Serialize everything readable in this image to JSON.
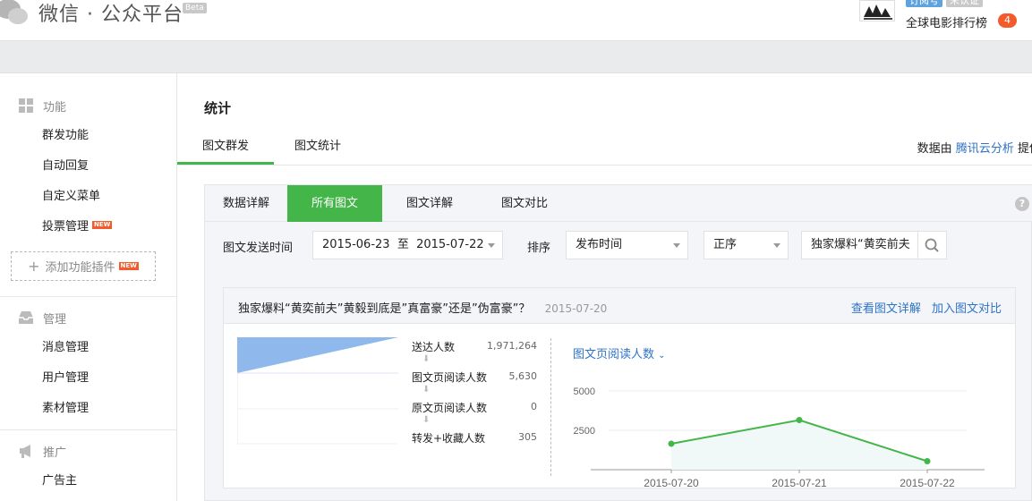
{
  "header": {
    "logo_text": "微信 · 公众平台",
    "beta": "Beta",
    "account_badge_sub": "订阅号",
    "account_badge_verify": "未认证",
    "account_name": "全球电影排行榜",
    "notification_count": "4"
  },
  "sidebar": {
    "groups": [
      {
        "title": "功能",
        "icon": "grid-icon"
      },
      {
        "title": "管理",
        "icon": "inbox-icon"
      },
      {
        "title": "推广",
        "icon": "megaphone-icon"
      }
    ],
    "function_items": [
      "群发功能",
      "自动回复",
      "自定义菜单",
      "投票管理"
    ],
    "new_tag": "NEW",
    "add_plugin": "添加功能插件",
    "manage_items": [
      "消息管理",
      "用户管理",
      "素材管理"
    ],
    "promo_items": [
      "广告主"
    ]
  },
  "main": {
    "title": "统计",
    "tabs": [
      "图文群发",
      "图文统计"
    ],
    "data_source_prefix": "数据由",
    "data_source_link": "腾讯云分析",
    "data_source_suffix": "提供",
    "subtabs": [
      "数据详解",
      "所有图文",
      "图文详解",
      "图文对比"
    ],
    "help": "?",
    "filters": {
      "time_label": "图文发送时间",
      "date_range": "2015-06-23  至  2015-07-22",
      "sort_label": "排序",
      "sort_field": "发布时间",
      "sort_order": "正序",
      "search_value": "独家爆料“黄奕前夫"
    },
    "card": {
      "title": "独家爆料“黄奕前夫”黄毅到底是”真富豪”还是”伪富豪”？",
      "date": "2015-07-20",
      "link_detail": "查看图文详解",
      "link_compare": "加入图文对比",
      "funnel": [
        {
          "label": "送达人数",
          "value": "1,971,264"
        },
        {
          "label": "图文页阅读人数",
          "value": "5,630"
        },
        {
          "label": "原文页阅读人数",
          "value": "0"
        },
        {
          "label": "转发+收藏人数",
          "value": "305"
        }
      ],
      "chart_title": "图文页阅读人数"
    }
  },
  "chart_data": {
    "type": "line",
    "x": [
      "2015-07-20",
      "2015-07-21",
      "2015-07-22"
    ],
    "series": [
      {
        "values": [
          1650,
          3150,
          540
        ]
      }
    ],
    "ylim": [
      0,
      5000
    ],
    "yticks": [
      "5000",
      "2500"
    ],
    "color": "#44b549",
    "fill": "#f1f8f8",
    "grid": true
  }
}
